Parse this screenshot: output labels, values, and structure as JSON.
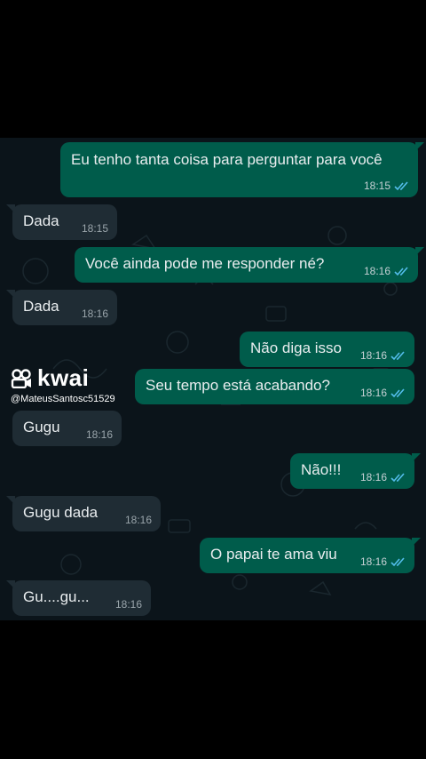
{
  "colors": {
    "outgoing_bubble": "#005c4b",
    "incoming_bubble": "#1f2c34",
    "chat_background": "#0b141a",
    "read_ticks": "#53bdeb"
  },
  "watermark": {
    "brand": "kwai",
    "handle": "@MateusSantosc51529",
    "icon": "kwai-logo-icon"
  },
  "messages": [
    {
      "direction": "out",
      "text": "Eu tenho tanta coisa para perguntar para você",
      "time": "18:15",
      "status": "read"
    },
    {
      "direction": "in",
      "text": "Dada",
      "time": "18:15"
    },
    {
      "direction": "out",
      "text": "Você ainda pode me responder né?",
      "time": "18:16",
      "status": "read"
    },
    {
      "direction": "in",
      "text": "Dada",
      "time": "18:16"
    },
    {
      "direction": "out",
      "text": "Não diga isso",
      "time": "18:16",
      "status": "read"
    },
    {
      "direction": "out",
      "text": "Seu tempo está acabando?",
      "time": "18:16",
      "status": "read"
    },
    {
      "direction": "in",
      "text": "Gugu",
      "time": "18:16"
    },
    {
      "direction": "out",
      "text": "Não!!!",
      "time": "18:16",
      "status": "read"
    },
    {
      "direction": "in",
      "text": "Gugu dada",
      "time": "18:16"
    },
    {
      "direction": "out",
      "text": "O papai te ama viu",
      "time": "18:16",
      "status": "read"
    },
    {
      "direction": "in",
      "text": "Gu....gu...",
      "time": "18:16"
    }
  ]
}
